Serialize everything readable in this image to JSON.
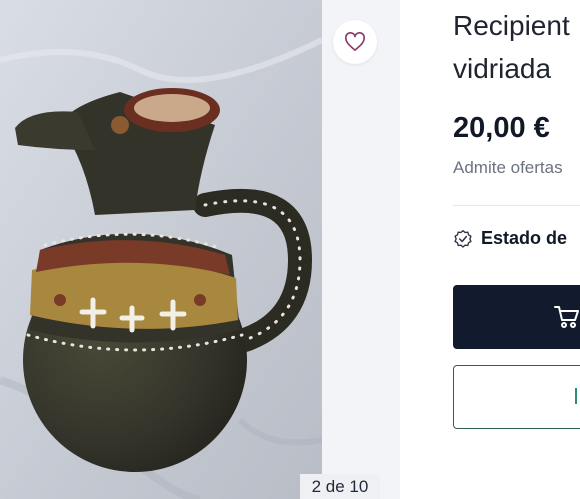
{
  "product": {
    "title_line1": "Recipient",
    "title_line2": "vidriada",
    "price": "20,00 €",
    "offers_note": "Admite ofertas",
    "condition_label": "Estado de"
  },
  "gallery": {
    "counter": "2 de 10"
  },
  "icons": {
    "favorite": "heart-icon",
    "condition": "verified-badge-icon",
    "buy": "cart-icon"
  },
  "colors": {
    "buy_button": "#111b2d",
    "offer_border": "#2f5f56",
    "heart": "#8a3a6a"
  }
}
